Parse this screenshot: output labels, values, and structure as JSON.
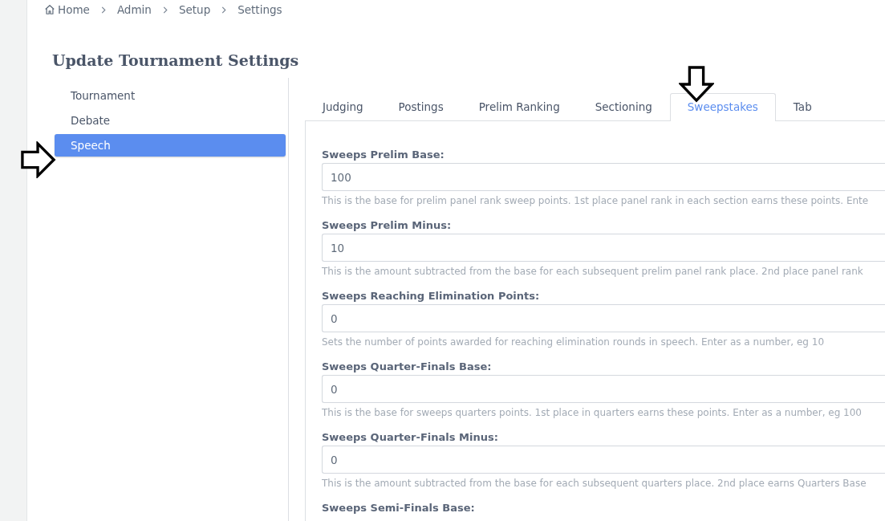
{
  "breadcrumb": [
    {
      "label": "Home",
      "kind": "home"
    },
    {
      "label": "Admin",
      "kind": "link"
    },
    {
      "label": "Setup",
      "kind": "link"
    },
    {
      "label": "Settings",
      "kind": "current"
    }
  ],
  "page_title": "Update Tournament Settings",
  "sidebar": {
    "items": [
      {
        "label": "Tournament",
        "selected": false
      },
      {
        "label": "Debate",
        "selected": false
      },
      {
        "label": "Speech",
        "selected": true
      }
    ]
  },
  "tabs": [
    {
      "label": "Judging",
      "selected": false
    },
    {
      "label": "Postings",
      "selected": false
    },
    {
      "label": "Prelim Ranking",
      "selected": false
    },
    {
      "label": "Sectioning",
      "selected": false
    },
    {
      "label": "Sweepstakes",
      "selected": true
    },
    {
      "label": "Tab",
      "selected": false
    }
  ],
  "fields": [
    {
      "label": "Sweeps Prelim Base:",
      "value": "100",
      "help": "This is the base for prelim panel rank sweep points. 1st place panel rank in each section earns these points. Ente"
    },
    {
      "label": "Sweeps Prelim Minus:",
      "value": "10",
      "help": "This is the amount subtracted from the base for each subsequent prelim panel rank place. 2nd place panel rank"
    },
    {
      "label": "Sweeps Reaching Elimination Points:",
      "value": "0",
      "help": "Sets the number of points awarded for reaching elimination rounds in speech. Enter as a number, eg 10"
    },
    {
      "label": "Sweeps Quarter-Finals Base:",
      "value": "0",
      "help": "This is the base for sweeps quarters points. 1st place in quarters earns these points. Enter as a number, eg 100"
    },
    {
      "label": "Sweeps Quarter-Finals Minus:",
      "value": "0",
      "help": "This is the amount subtracted from the base for each subsequent quarters place. 2nd place earns Quarters Base"
    },
    {
      "label": "Sweeps Semi-Finals Base:"
    }
  ]
}
